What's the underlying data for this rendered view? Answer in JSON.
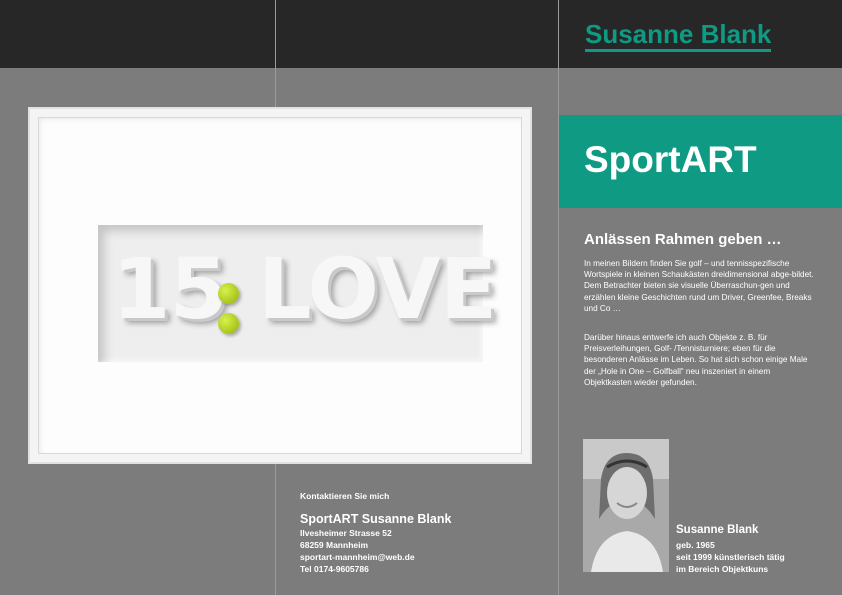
{
  "brand": {
    "name": "Susanne Blank"
  },
  "title": {
    "light": "Sport",
    "bold": "ART"
  },
  "intro": {
    "heading": "Anlässen Rahmen geben …",
    "paragraph1": "In meinen Bildern finden Sie golf – und tennisspezifische Wortspiele in kleinen Schaukästen dreidimensional abge-bildet. Dem Betrachter bieten sie visuelle Überraschun-gen und erzählen kleine Geschichten rund um Driver, Greenfee, Breaks und Co …",
    "paragraph2": "Darüber hinaus entwerfe ich auch Objekte z. B. für Preisverleihungen, Golf- /Tennisturniere; eben für die besonderen Anlässe im Leben. So hat sich schon einige Male der „Hole in One – Golfball“ neu inszeniert in einem Objektkasten wieder gefunden."
  },
  "artwork": {
    "left": "15",
    "right": "LOVE"
  },
  "contact": {
    "label": "Kontaktieren Sie mich",
    "company": "SportART Susanne Blank",
    "street": "Ilvesheimer Strasse 52",
    "city": "68259 Mannheim",
    "email": "sportart-mannheim@web.de",
    "phone": "Tel 0174-9605786"
  },
  "bio": {
    "name": "Susanne Blank",
    "born": "geb. 1965",
    "line1": "seit 1999 künstlerisch tätig",
    "line2": "im Bereich Objektkuns"
  },
  "colors": {
    "accent": "#0f9a84",
    "topbar": "#272727",
    "background": "#7c7c7c"
  }
}
